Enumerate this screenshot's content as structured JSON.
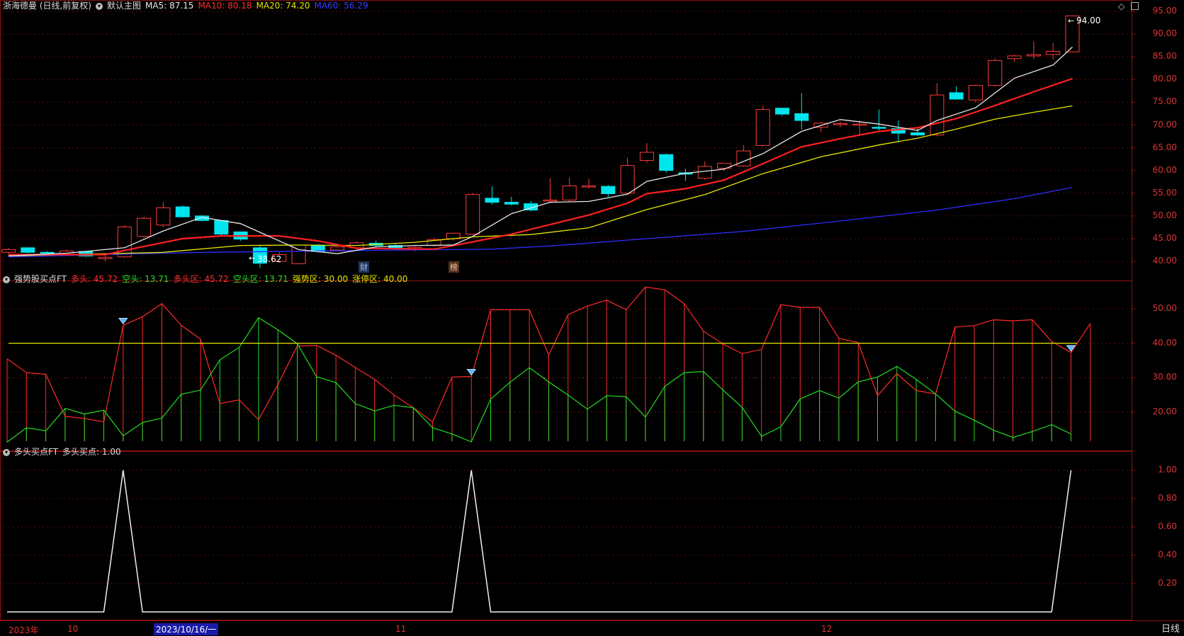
{
  "main_panel": {
    "stock": "浙海德曼 (日线,前复权)",
    "template": "默认主图",
    "ma5": {
      "label": "MA5: 87.15",
      "color": "#e8e8e8"
    },
    "ma10": {
      "label": "MA10: 80.18",
      "color": "#ff2a2a"
    },
    "ma20": {
      "label": "MA20: 74.20",
      "color": "#e6e600"
    },
    "ma60": {
      "label": "MA60: 56.29",
      "color": "#2e2eff"
    },
    "high_marker": "94.00",
    "low_marker": "38.62",
    "tag_cai": "财",
    "tag_bang": "榜",
    "y_ticks": [
      "95.00",
      "90.00",
      "85.00",
      "80.00",
      "75.00",
      "70.00",
      "65.00",
      "60.00",
      "55.00",
      "50.00",
      "45.00",
      "40.00"
    ]
  },
  "panel2": {
    "title": "强势股买点FT",
    "duotou": "多头: 45.72",
    "kongtou": "空头: 13.71",
    "duotouqu": "多头区: 45.72",
    "kongtouqu": "空头区: 13.71",
    "qiangshiqu": "强势区: 30.00",
    "zhangtingqu": "涨停区: 40.00",
    "y_ticks": [
      "50.00",
      "40.00",
      "30.00",
      "20.00"
    ]
  },
  "panel3": {
    "title": "多头买点FT",
    "value": "多头买点: 1.00",
    "y_ticks": [
      "1.00",
      "0.80",
      "0.60",
      "0.40",
      "0.20"
    ]
  },
  "date_axis": {
    "year": "2023年",
    "m10": "10",
    "selected": "2023/10/16/一",
    "m11": "11",
    "m12": "12",
    "period": "日线"
  },
  "chart_data": {
    "type": "candlestick",
    "candles": [
      [
        42,
        43,
        41.6,
        42.6
      ],
      [
        43,
        43,
        41.8,
        42
      ],
      [
        42,
        42.3,
        41.5,
        41.8
      ],
      [
        41.6,
        42.6,
        41.3,
        42.3
      ],
      [
        42.2,
        42.2,
        41,
        41.2
      ],
      [
        40.6,
        41.3,
        40,
        40.9
      ],
      [
        41,
        48,
        40.8,
        47.6
      ],
      [
        45.5,
        49.8,
        45.2,
        49.5
      ],
      [
        48,
        53,
        47.5,
        51.8
      ],
      [
        52,
        52.3,
        49.7,
        49.8
      ],
      [
        50,
        50.2,
        48.8,
        49
      ],
      [
        49,
        49,
        45.7,
        46
      ],
      [
        46.5,
        46.5,
        44.5,
        44.9
      ],
      [
        43,
        43.5,
        38.6,
        39.6
      ],
      [
        40,
        42,
        39.7,
        41.5
      ],
      [
        39.5,
        43.7,
        39.4,
        43.6
      ],
      [
        43.6,
        43.8,
        42,
        42.2
      ],
      [
        42.5,
        43.7,
        42.3,
        43.2
      ],
      [
        43,
        44.4,
        42.5,
        44.1
      ],
      [
        44,
        44.6,
        43.2,
        43.5
      ],
      [
        43.5,
        44,
        42.7,
        42.9
      ],
      [
        42.6,
        43.4,
        42.2,
        43.1
      ],
      [
        43.5,
        45.2,
        43.2,
        44.8
      ],
      [
        45,
        46.3,
        44.6,
        46.2
      ],
      [
        46,
        55,
        45.8,
        54.7
      ],
      [
        53.9,
        56.5,
        52.5,
        53
      ],
      [
        53,
        54.2,
        52.3,
        52.6
      ],
      [
        52.7,
        53.3,
        51,
        51.3
      ],
      [
        53.4,
        58.3,
        52.8,
        53.5
      ],
      [
        53.5,
        58.5,
        53.2,
        56.6
      ],
      [
        56.6,
        58.2,
        56,
        56.6
      ],
      [
        56.5,
        56.8,
        54.2,
        54.9
      ],
      [
        55,
        62.8,
        54.8,
        61.1
      ],
      [
        62.2,
        66,
        61.7,
        64
      ],
      [
        63.5,
        63.7,
        59.5,
        60
      ],
      [
        59.5,
        60.4,
        57.7,
        59.2
      ],
      [
        58.3,
        62,
        58,
        60.9
      ],
      [
        60.5,
        61.5,
        59.9,
        61.6
      ],
      [
        61,
        65.6,
        60.8,
        64.3
      ],
      [
        65.5,
        74.2,
        65.3,
        73.4
      ],
      [
        73.7,
        73.7,
        72,
        72.4
      ],
      [
        72.5,
        77,
        69,
        71
      ],
      [
        69.5,
        70.7,
        68.4,
        70.4
      ],
      [
        70.3,
        70.8,
        69.5,
        70.3
      ],
      [
        70,
        71,
        67.7,
        70.2
      ],
      [
        69.5,
        73.4,
        68.8,
        69.3
      ],
      [
        69.2,
        71,
        66.2,
        68.2
      ],
      [
        68.3,
        69.2,
        67.6,
        67.8
      ],
      [
        67.8,
        79.2,
        67.5,
        76.6
      ],
      [
        77.1,
        78.6,
        75.7,
        75.7
      ],
      [
        75.5,
        78.9,
        75,
        78.7
      ],
      [
        78.7,
        84.6,
        78.4,
        84.2
      ],
      [
        84.6,
        85.5,
        83.9,
        85.2
      ],
      [
        85.2,
        88.4,
        84.5,
        85.5
      ],
      [
        85.5,
        88,
        84.4,
        86.2
      ],
      [
        86.1,
        94,
        86,
        94
      ]
    ],
    "ma5": [
      [
        0,
        41.2
      ],
      [
        3,
        41.8
      ],
      [
        6,
        43
      ],
      [
        8,
        46.7
      ],
      [
        10,
        49.7
      ],
      [
        12,
        48.3
      ],
      [
        13,
        46.4
      ],
      [
        15,
        42.6
      ],
      [
        17,
        41.7
      ],
      [
        19,
        43.2
      ],
      [
        21,
        43.5
      ],
      [
        23,
        43.6
      ],
      [
        24,
        45.5
      ],
      [
        26,
        50.5
      ],
      [
        28,
        53
      ],
      [
        30,
        53.2
      ],
      [
        32,
        54.8
      ],
      [
        33,
        57.6
      ],
      [
        35,
        59.4
      ],
      [
        37,
        60.3
      ],
      [
        39,
        63.7
      ],
      [
        41,
        68.6
      ],
      [
        43,
        71.2
      ],
      [
        45,
        70.2
      ],
      [
        47,
        68.8
      ],
      [
        48,
        71
      ],
      [
        50,
        73.8
      ],
      [
        52,
        80.3
      ],
      [
        54,
        83.2
      ],
      [
        55,
        87.15
      ]
    ],
    "ma10": [
      [
        0,
        41.5
      ],
      [
        5,
        41.5
      ],
      [
        7,
        43.3
      ],
      [
        9,
        45
      ],
      [
        11,
        45.6
      ],
      [
        14,
        45.6
      ],
      [
        16,
        44.5
      ],
      [
        18,
        42.9
      ],
      [
        20,
        42.8
      ],
      [
        22,
        42.7
      ],
      [
        24,
        44.3
      ],
      [
        26,
        46
      ],
      [
        28,
        48.1
      ],
      [
        30,
        50.2
      ],
      [
        32,
        52.8
      ],
      [
        33,
        54.9
      ],
      [
        35,
        56
      ],
      [
        37,
        57.9
      ],
      [
        39,
        61.5
      ],
      [
        41,
        65.2
      ],
      [
        43,
        67
      ],
      [
        45,
        68.6
      ],
      [
        47,
        69.4
      ],
      [
        49,
        71.4
      ],
      [
        51,
        74.3
      ],
      [
        53,
        77.3
      ],
      [
        55,
        80.18
      ]
    ],
    "ma20": [
      [
        0,
        41.2
      ],
      [
        8,
        42
      ],
      [
        12,
        43.5
      ],
      [
        15,
        43.6
      ],
      [
        18,
        43.5
      ],
      [
        21,
        44.2
      ],
      [
        24,
        45.4
      ],
      [
        27,
        45.9
      ],
      [
        30,
        47.4
      ],
      [
        33,
        51.4
      ],
      [
        36,
        54.7
      ],
      [
        39,
        59.3
      ],
      [
        42,
        63
      ],
      [
        45,
        65.6
      ],
      [
        47,
        67.1
      ],
      [
        49,
        69.1
      ],
      [
        51,
        71.3
      ],
      [
        53,
        72.8
      ],
      [
        55,
        74.2
      ]
    ],
    "ma60": [
      [
        0,
        41
      ],
      [
        10,
        42
      ],
      [
        20,
        42.5
      ],
      [
        25,
        42.7
      ],
      [
        28,
        43.4
      ],
      [
        33,
        45
      ],
      [
        38,
        46.6
      ],
      [
        43,
        48.9
      ],
      [
        48,
        51.3
      ],
      [
        52,
        53.8
      ],
      [
        55,
        56.29
      ]
    ],
    "bull": [
      35.5,
      31.5,
      31,
      18.8,
      18.2,
      17.2,
      45.2,
      47.7,
      51.5,
      45.2,
      41.2,
      22.5,
      23.6,
      17.8,
      28,
      39.2,
      39.4,
      36.5,
      33,
      29.5,
      25,
      21.3,
      17.2,
      30.2,
      30.4,
      49.7,
      49.7,
      49.7,
      36.6,
      48.3,
      50.8,
      52.5,
      49.7,
      56.3,
      55.5,
      51.5,
      43.5,
      39.8,
      37,
      38.2,
      51.2,
      50.4,
      50.4,
      41.4,
      40.2,
      24.8,
      31.2,
      26.3,
      25.3,
      44.7,
      45.1,
      46.8,
      46.5,
      46.8,
      40.5,
      37.3,
      45.72
    ],
    "bear": [
      11.3,
      15.5,
      14.6,
      21.1,
      19.5,
      20.6,
      13.2,
      17,
      18.3,
      25.2,
      26.4,
      35.2,
      38.8,
      47.4,
      43.9,
      39.9,
      30.3,
      28.6,
      22.5,
      20.4,
      22,
      21.3,
      15.5,
      13.7,
      11.4,
      23.8,
      28.7,
      32.9,
      28.8,
      25,
      20.9,
      24.8,
      24.5,
      18.6,
      27.5,
      31.5,
      31.8,
      26.5,
      21.4,
      13,
      15.8,
      23.9,
      26.3,
      24.1,
      28.8,
      30.2,
      33.3,
      29.5,
      25.3,
      20.3,
      17.7,
      14.8,
      12.7,
      14.4,
      16.4,
      13.71
    ],
    "strong_zone": 30.0,
    "limit_zone": 40.0,
    "buy_signals": [
      6,
      24,
      55
    ],
    "buy_point": [
      0,
      0,
      0,
      0,
      0,
      0,
      1,
      0,
      0,
      0,
      0,
      0,
      0,
      0,
      0,
      0,
      0,
      0,
      0,
      0,
      0,
      0,
      0,
      0,
      1,
      0,
      0,
      0,
      0,
      0,
      0,
      0,
      0,
      0,
      0,
      0,
      0,
      0,
      0,
      0,
      0,
      0,
      0,
      0,
      0,
      0,
      0,
      0,
      0,
      0,
      0,
      0,
      0,
      0,
      0,
      1
    ]
  }
}
